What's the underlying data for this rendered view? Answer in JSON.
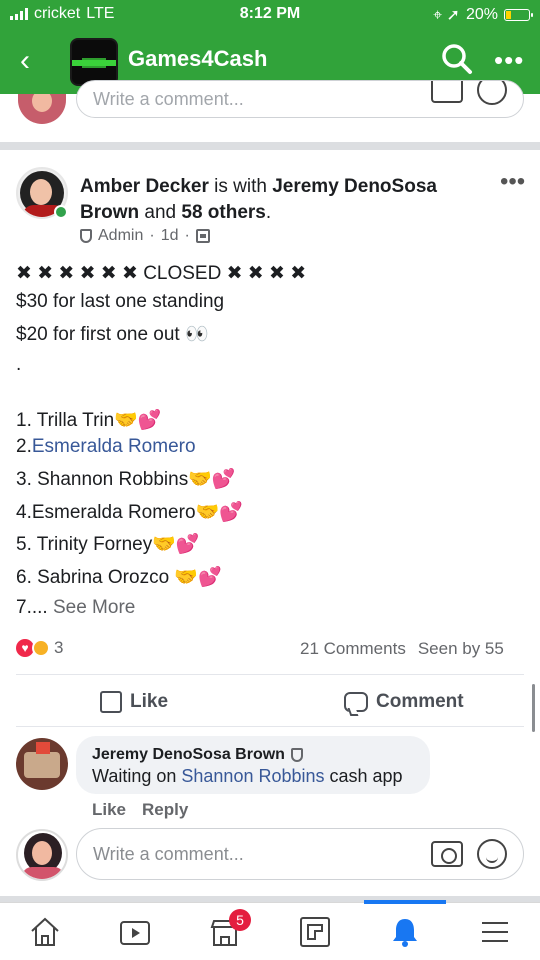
{
  "status_bar": {
    "carrier": "cricket",
    "network": "LTE",
    "time": "8:12 PM",
    "battery": "20%"
  },
  "app_bar": {
    "title": "Games4Cash",
    "back_icon": "chevron-left-icon",
    "search_icon": "search-icon",
    "more_icon": "more-dots-icon"
  },
  "top_comment": {
    "placeholder": "Write a comment..."
  },
  "post": {
    "author": "Amber Decker",
    "with_text": " is with ",
    "tagged": "Jeremy DenoSosa Brown",
    "and_text": " and ",
    "others": "58 others",
    "role": "Admin",
    "time": "1d",
    "lines": [
      "✖ ✖ ✖ ✖ ✖ ✖ CLOSED ✖ ✖ ✖ ✖",
      "$30 for last one standing",
      "$20 for first one out 👀",
      ".",
      "1. Trilla Trin🤝💕",
      "2.",
      "3. Shannon Robbins🤝💕",
      "4.Esmeralda Romero🤝💕",
      "5. Trinity Forney🤝💕",
      "6. Sabrina Orozco 🤝💕",
      "7.... "
    ],
    "line2_link": "Esmeralda Romero",
    "see_more": "See More"
  },
  "engagement": {
    "reaction_count": "3",
    "comments": "21 Comments",
    "seen_by": "Seen by 55"
  },
  "actions": {
    "like": "Like",
    "comment": "Comment"
  },
  "comment": {
    "author": "Jeremy DenoSosa Brown",
    "text_before": "Waiting on ",
    "mention": "Shannon Robbins",
    "text_after": " cash app",
    "like": "Like",
    "reply": "Reply"
  },
  "write_comment": {
    "placeholder": "Write a comment..."
  },
  "tabbar": {
    "marketplace_badge": "5",
    "items": [
      "home-icon",
      "watch-icon",
      "marketplace-icon",
      "groups-icon",
      "notifications-icon",
      "menu-icon"
    ]
  },
  "colors": {
    "brand_green": "#31a33a",
    "link_blue": "#385898",
    "active_tab": "#1877f2"
  }
}
